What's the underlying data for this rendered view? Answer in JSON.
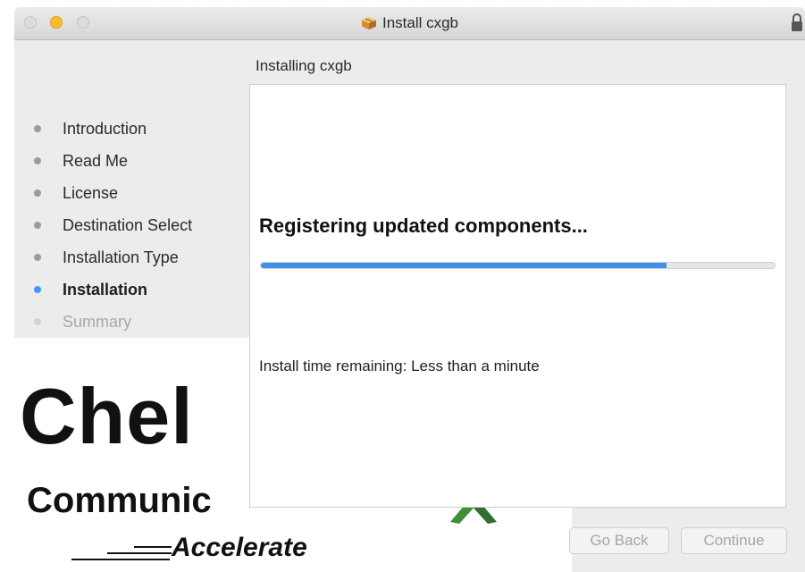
{
  "window": {
    "title": "Install cxgb",
    "icon": "package-icon"
  },
  "sidebar": {
    "steps": [
      {
        "label": "Introduction",
        "state": "done"
      },
      {
        "label": "Read Me",
        "state": "done"
      },
      {
        "label": "License",
        "state": "done"
      },
      {
        "label": "Destination Select",
        "state": "done"
      },
      {
        "label": "Installation Type",
        "state": "done"
      },
      {
        "label": "Installation",
        "state": "current"
      },
      {
        "label": "Summary",
        "state": "pending"
      }
    ]
  },
  "main": {
    "header": "Installing cxgb",
    "status": "Registering updated components...",
    "progress_percent": 79,
    "time_remaining": "Install time remaining: Less than a minute"
  },
  "branding": {
    "logo_word": "Chel",
    "logo_sub": "Communic",
    "tagline": "Accelerate"
  },
  "footer": {
    "back_label": "Go Back",
    "continue_label": "Continue"
  },
  "colors": {
    "accent": "#3e90e8",
    "current_step_dot": "#3d9df3",
    "minimize_button": "#f6be2f"
  }
}
